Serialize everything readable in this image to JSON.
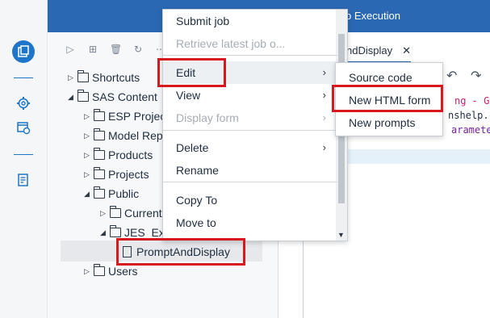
{
  "window": {
    "title": "b Execution"
  },
  "rail": {
    "icons": [
      "content-icon",
      "gear-icon",
      "jobs-icon",
      "log-icon"
    ]
  },
  "toolbar": {
    "icons": [
      "play-icon",
      "new-icon",
      "delete-icon",
      "refresh-icon",
      "more-icon"
    ]
  },
  "tree": {
    "nodes": [
      {
        "label": "Shortcuts",
        "indent": 0,
        "expanded": false
      },
      {
        "label": "SAS Content",
        "indent": 0,
        "expanded": true
      },
      {
        "label": "ESP Project",
        "indent": 1,
        "expanded": false
      },
      {
        "label": "Model Rep",
        "indent": 1,
        "expanded": false
      },
      {
        "label": "Products",
        "indent": 1,
        "expanded": false
      },
      {
        "label": "Projects",
        "indent": 1,
        "expanded": false
      },
      {
        "label": "Public",
        "indent": 1,
        "expanded": true
      },
      {
        "label": "Current",
        "indent": 2,
        "expanded": false
      },
      {
        "label": "JES_Exa",
        "indent": 2,
        "expanded": true
      },
      {
        "label": "PromptAndDisplay",
        "indent": 3,
        "selected": true
      },
      {
        "label": "Users",
        "indent": 1,
        "expanded": false
      }
    ]
  },
  "editor": {
    "tab_label": "ndDisplay",
    "code_lines": [
      "ng - Ge",
      "nshelp.c",
      "arameter"
    ]
  },
  "context_menu": {
    "items": [
      {
        "label": "Submit job",
        "disabled": false,
        "submenu": false
      },
      {
        "label": "Retrieve latest job o...",
        "disabled": true,
        "submenu": false
      },
      {
        "label": "Edit",
        "disabled": false,
        "submenu": true,
        "hover": true
      },
      {
        "label": "View",
        "disabled": false,
        "submenu": true
      },
      {
        "label": "Display form",
        "disabled": true,
        "submenu": true
      },
      {
        "label": "Delete",
        "disabled": false,
        "submenu": true
      },
      {
        "label": "Rename",
        "disabled": false,
        "submenu": false
      },
      {
        "label": "Copy To",
        "disabled": false,
        "submenu": false
      },
      {
        "label": "Move to",
        "disabled": false,
        "submenu": false
      }
    ],
    "arrow_glyph": "›"
  },
  "edit_submenu": {
    "items": [
      {
        "label": "Source code"
      },
      {
        "label": "New HTML form"
      },
      {
        "label": "New prompts"
      }
    ]
  },
  "colors": {
    "accent": "#2b68b4",
    "highlight_box": "#d7191f"
  }
}
